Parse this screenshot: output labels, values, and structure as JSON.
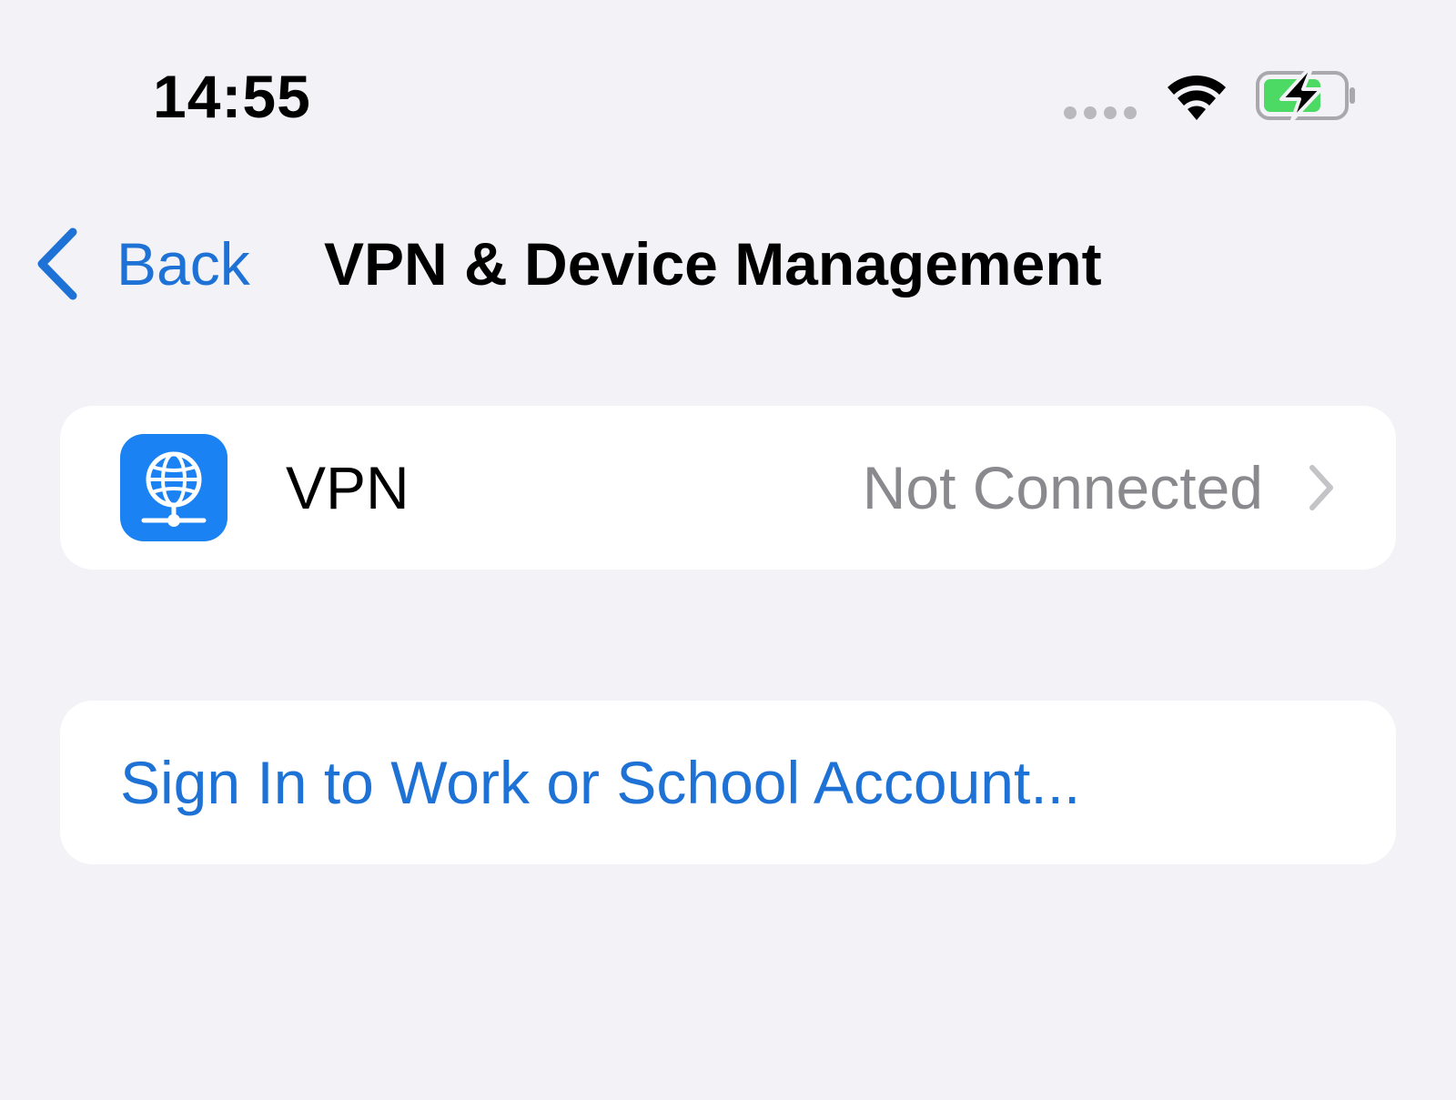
{
  "status_bar": {
    "time": "14:55",
    "icons": [
      "signal-dots-icon",
      "wifi-icon",
      "battery-charging-icon"
    ]
  },
  "nav": {
    "back_label": "Back",
    "title": "VPN & Device Management"
  },
  "vpn_row": {
    "icon": "vpn-globe-icon",
    "label": "VPN",
    "status": "Not Connected"
  },
  "signin_row": {
    "label": "Sign In to Work or School Account..."
  },
  "colors": {
    "background": "#f2f2f7",
    "accent": "#1e72d6",
    "icon_blue": "#1a82f2",
    "secondary_text": "#8a8a8e",
    "battery_green": "#4cd964"
  }
}
